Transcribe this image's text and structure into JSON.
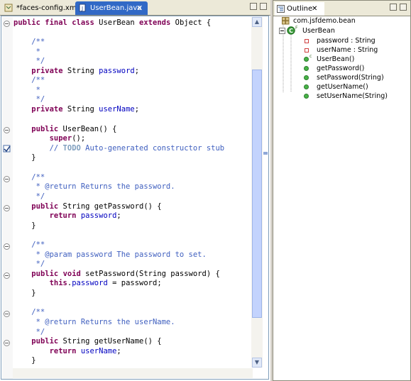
{
  "editor": {
    "tabs": [
      {
        "label": "*faces-config.xml",
        "icon": "xml-file-icon"
      },
      {
        "label": "UserBean.java",
        "icon": "java-file-icon",
        "close": "✕"
      }
    ],
    "code": [
      "public final class UserBean extends Object {",
      "",
      "    /**",
      "     * ",
      "     */",
      "    private String password;",
      "    /**",
      "     * ",
      "     */",
      "    private String userName;",
      "",
      "    public UserBean() {",
      "        super();",
      "        // TODO Auto-generated constructor stub",
      "    }",
      "",
      "    /**",
      "     * @return Returns the password.",
      "     */",
      "    public String getPassword() {",
      "        return password;",
      "    }",
      "",
      "    /**",
      "     * @param password The password to set.",
      "     */",
      "    public void setPassword(String password) {",
      "        this.password = password;",
      "    }",
      "",
      "    /**",
      "     * @return Returns the userName.",
      "     */",
      "    public String getUserName() {",
      "        return userName;",
      "    }"
    ]
  },
  "outline": {
    "tab_label": "Outline",
    "tab_close": "✕",
    "items": [
      {
        "label": "com.jsfdemo.bean",
        "icon": "package-icon"
      },
      {
        "label": "UserBean",
        "icon": "class-icon"
      },
      {
        "label": "password : String",
        "icon": "private-field-icon"
      },
      {
        "label": "userName : String",
        "icon": "private-field-icon"
      },
      {
        "label": "UserBean()",
        "icon": "constructor-icon"
      },
      {
        "label": "getPassword()",
        "icon": "public-method-icon"
      },
      {
        "label": "setPassword(String)",
        "icon": "public-method-icon"
      },
      {
        "label": "getUserName()",
        "icon": "public-method-icon"
      },
      {
        "label": "setUserName(String)",
        "icon": "public-method-icon"
      }
    ]
  }
}
